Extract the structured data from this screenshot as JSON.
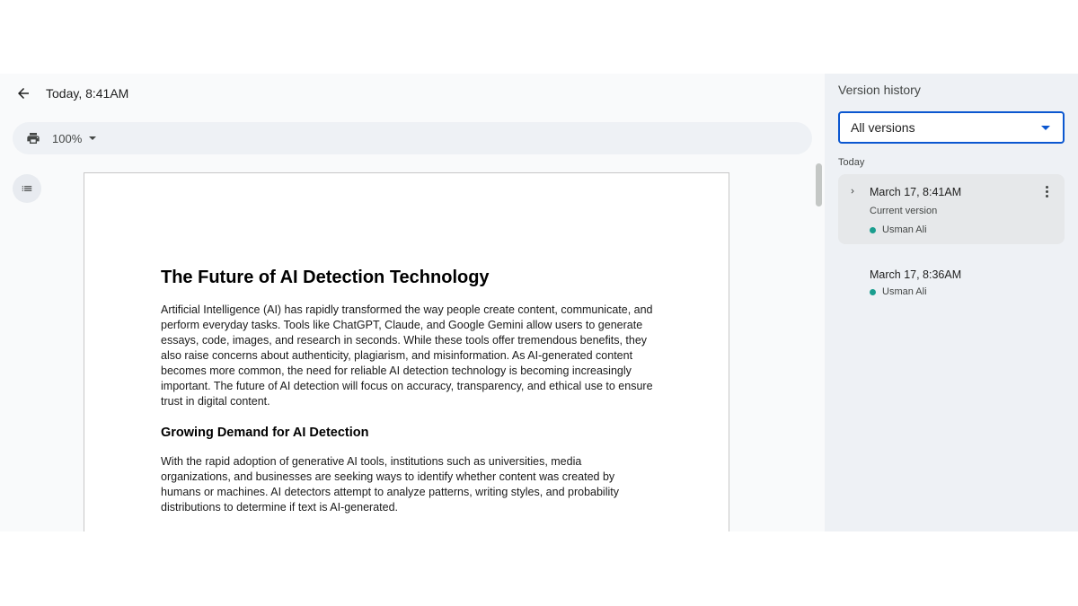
{
  "header": {
    "back_icon": "arrow-left-icon",
    "title": "Today, 8:41AM"
  },
  "toolbar": {
    "print_icon": "printer-icon",
    "zoom": "100%"
  },
  "outline_icon": "list-icon",
  "document": {
    "title": "The Future of AI Detection Technology",
    "paragraph1": "Artificial Intelligence (AI) has rapidly transformed the way people create content, communicate, and perform everyday tasks. Tools like ChatGPT, Claude, and Google Gemini allow users to generate essays, code, images, and research in seconds. While these tools offer tremendous benefits, they also raise concerns about authenticity, plagiarism, and misinformation. As AI-generated content becomes more common, the need for reliable AI detection technology is becoming increasingly important. The future of AI detection will focus on accuracy, transparency, and ethical use to ensure trust in digital content.",
    "heading2": "Growing Demand for AI Detection",
    "paragraph2": "With the rapid adoption of generative AI tools, institutions such as universities, media organizations, and businesses are seeking ways to identify whether content was created by humans or machines. AI detectors attempt to analyze patterns, writing styles, and probability distributions to determine if text is AI-generated."
  },
  "panel": {
    "title": "Version history",
    "filter": {
      "selected": "All versions"
    },
    "group_label": "Today",
    "versions": [
      {
        "time": "March 17, 8:41AM",
        "note": "Current version",
        "author": "Usman Ali",
        "author_color": "#1a9e8f"
      },
      {
        "time": "March 17, 8:36AM",
        "author": "Usman Ali",
        "author_color": "#1a9e8f"
      }
    ]
  },
  "colors": {
    "accent": "#0b57d0",
    "panel_bg": "#eef1f5",
    "active_version_bg": "#e6e8ea"
  }
}
